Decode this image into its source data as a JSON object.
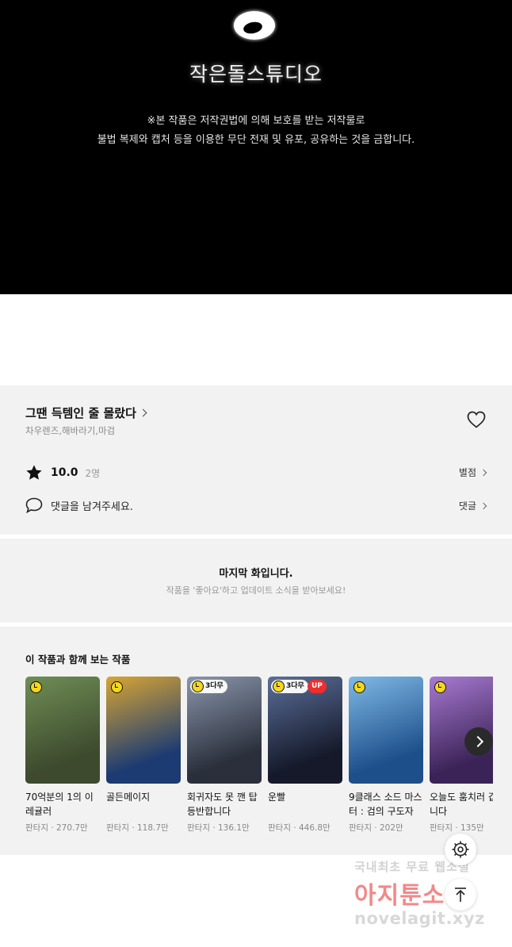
{
  "banner": {
    "studio_name": "작은돌스튜디오",
    "notice_line1": "※본 작품은 저작권법에 의해 보호를 받는 저작물로",
    "notice_line2": "불법 복제와 캡처 등을 이용한 무단 전재 및 유포, 공유하는 것을 금합니다."
  },
  "work": {
    "title": "그땐 득템인 줄 몰랐다",
    "authors": "차우렌즈,해바라기,마검",
    "rating": "10.0",
    "rating_count": "2명",
    "rate_link": "별점",
    "comment_prompt": "댓글을 남겨주세요.",
    "comment_link": "댓글"
  },
  "last_episode": {
    "title": "마지막 화입니다.",
    "subtitle": "작품을 '좋아요'하고 업데이트 소식을 받아보세요!"
  },
  "recommend": {
    "heading": "이 작품과 함께 보는 작품",
    "items": [
      {
        "name": "70억분의 1의 이레귤러",
        "genre": "판타지",
        "views": "270.7만",
        "badge": "",
        "up": "",
        "colors": [
          "#3d4a2e",
          "#6f8d55"
        ]
      },
      {
        "name": "골든메이지",
        "genre": "판타지",
        "views": "118.7만",
        "badge": "",
        "up": "",
        "colors": [
          "#1c3b72",
          "#d8a533"
        ]
      },
      {
        "name": "회귀자도 못 깬 탑 등반합니다",
        "genre": "판타지",
        "views": "136.1만",
        "badge": "3다무",
        "up": "",
        "colors": [
          "#2a2f3b",
          "#8a96ab"
        ]
      },
      {
        "name": "운빨",
        "genre": "판타지",
        "views": "446.8만",
        "badge": "3다무",
        "up": "UP",
        "colors": [
          "#15192a",
          "#5b6f99"
        ]
      },
      {
        "name": "9클래스 소드 마스터 : 검의 구도자",
        "genre": "판타지",
        "views": "202만",
        "badge": "",
        "up": "",
        "colors": [
          "#1d4f8a",
          "#7fb9e6"
        ]
      },
      {
        "name": "오늘도 훔치러 갑니다",
        "genre": "판타지",
        "views": "135만",
        "badge": "",
        "up": "",
        "colors": [
          "#3b2357",
          "#a77ad1"
        ]
      }
    ]
  },
  "watermark": {
    "line1": "국내최초 무료 웹소설",
    "line2": "아지툰소설",
    "line3": "novelagit.xyz"
  },
  "icons": {
    "logo": "studio-logo-icon",
    "heart": "heart-icon",
    "star": "star-icon",
    "comment": "comment-bubble-icon",
    "next": "chevron-right-icon",
    "settings": "gear-icon",
    "top": "arrow-up-icon"
  }
}
